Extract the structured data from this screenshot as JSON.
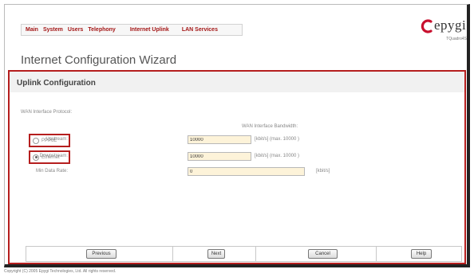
{
  "menu": {
    "items": [
      {
        "label": "Main"
      },
      {
        "label": "System"
      },
      {
        "label": "Users"
      },
      {
        "label": "Telephony"
      },
      {
        "label": "Internet Uplink"
      },
      {
        "label": "LAN Services"
      }
    ]
  },
  "brand": {
    "name": "epygi",
    "model": "TQuadro4S",
    "logo_color": "#c8102e"
  },
  "page": {
    "title": "Internet Configuration Wizard"
  },
  "panel": {
    "title": "Uplink Configuration",
    "protocol_label": "WAN Interface Protocol:",
    "bandwidth_label": "WAN Interface Bandwidth:",
    "protocol_options": [
      {
        "label": "PPPoE",
        "checked": false
      },
      {
        "label": "Ethernet",
        "checked": true
      }
    ],
    "fields": {
      "upstream": {
        "label": "Upstream:",
        "value": "10000",
        "unit": "[kbit/s] (max. 10000 )"
      },
      "downstream": {
        "label": "Downstream:",
        "value": "10000",
        "unit": "[kbit/s] (max. 10000 )"
      },
      "min_rate": {
        "label": "Min Data Rate:",
        "value": "0",
        "unit": "[kbit/s]"
      }
    }
  },
  "buttons": {
    "previous": "Previous",
    "next": "Next",
    "cancel": "Cancel",
    "help": "Help"
  },
  "footer": {
    "copyright": "Copyright (C) 2005 Epygi Technologies, Ltd. All rights reserved."
  },
  "colors": {
    "accent_red": "#b51e1e",
    "input_bg": "#fdf3d9"
  }
}
